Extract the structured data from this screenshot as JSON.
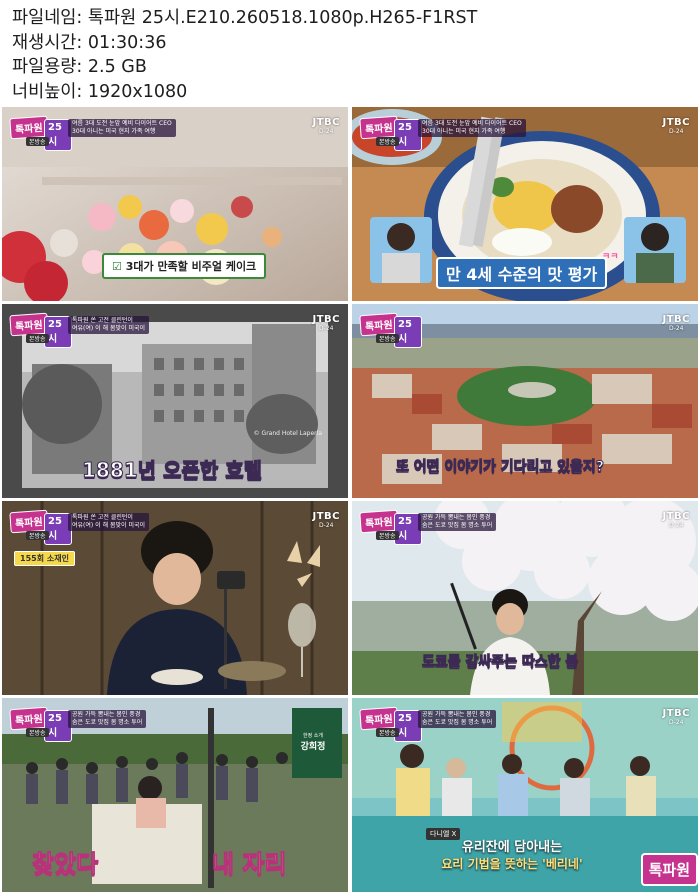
{
  "meta": {
    "rows": [
      {
        "key": "파일네임:",
        "value": "톡파원 25시.E210.260518.1080p.H265-F1RST"
      },
      {
        "key": "재생시간:",
        "value": "01:30:36"
      },
      {
        "key": "파일용량:",
        "value": "2.5 GB"
      },
      {
        "key": "너비높이:",
        "value": "1920x1080"
      }
    ]
  },
  "logo": {
    "part1": "톡파원",
    "part2": "25시",
    "sub": "본방송"
  },
  "channel": {
    "name": "JTBC",
    "sub": "D-24"
  },
  "thumbs": [
    {
      "tagline": [
        "여름 3대 도전 눈앞 예비 다이어트 CEO",
        "30대 아니는 미국 현지 가족 여행"
      ],
      "caption": "3대가 만족할 비주얼 케이크"
    },
    {
      "tagline": [
        "여름 3대 도전 눈앞 예비 다이어트 CEO",
        "30대 아니는 미국 현지 가족 여행"
      ],
      "caption": "만 4세 수준의 맛 평가",
      "caption_accent": "ㅋㅋ"
    },
    {
      "tagline": [
        "톡파원 쏜 고전 클린턴이",
        "여유(여) 이 해 봄맞이 미국이"
      ],
      "caption": "1881년 오픈한 호텔",
      "credit": "© Grand Hotel Laperla"
    },
    {
      "caption": "또 어떤 이야기가 기다리고 있을지?"
    },
    {
      "tagline": [
        "톡파원 쏜 고전 클린턴이",
        "여유(여) 이 해 봄맞이 미국이"
      ],
      "badge": "155회 소재인"
    },
    {
      "tagline": [
        "공원 가득 뽐내는 봄인 풍경",
        "숨은 도쿄 맛집 봄 명소 투어"
      ],
      "caption": "도쿄를 감싸주는 따스한 봄"
    },
    {
      "tagline": [
        "공원 가득 뽐내는 봄인 풍경",
        "숨은 도쿄 맛집 봄 명소 투어"
      ],
      "sign_top": "한정 소개",
      "sign_main": "강희정",
      "caption_left": "찾았다",
      "caption_right": "내 자리"
    },
    {
      "tagline": [
        "공원 가득 뽐내는 봄인 풍경",
        "숨은 도쿄 맛집 봄 명소 투어"
      ],
      "speaker": "다니엘 X",
      "subtitle_line1": "유리잔에 담아내는",
      "subtitle_line2": "요리 기법을 뜻하는 '베리네'",
      "corner_logo": "톡파원"
    }
  ]
}
